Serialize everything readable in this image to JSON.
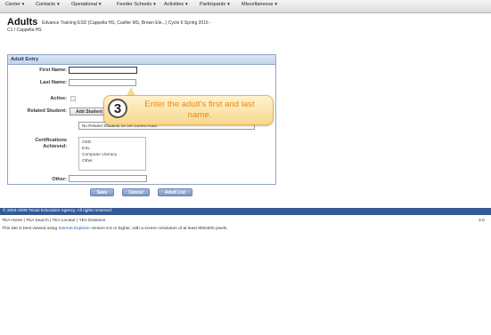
{
  "nav": {
    "items": [
      "Center",
      "Contacts",
      "Operational",
      "Feeder Schools",
      "Activities",
      "Participants",
      "Miscellaneous"
    ]
  },
  "page": {
    "title": "Adults",
    "subtitle": "Edvance Training ESD (Cappella HS, Cueller MS, Brown Ele...)  Cycle 6  Spring 2016 -",
    "subtitle2": "C1 / Cappella HS"
  },
  "form": {
    "panel_title": "Adult Entry",
    "first_name_label": "First Name:",
    "first_name_value": "",
    "last_name_label": "Last Name:",
    "last_name_value": "",
    "active_label": "Active:",
    "related_label": "Related Student:",
    "add_student_label": "Add Student",
    "related_empty": "No Related Students for the current Adult.",
    "certifications_label": "Certifications Achieved:",
    "certifications_options": [
      "GED",
      "ESL",
      "Computer Literacy",
      "Other"
    ],
    "other_label": "Other:",
    "other_value": ""
  },
  "buttons": {
    "save": "Save",
    "cancel": "Cancel",
    "adult_list": "Adult List"
  },
  "callout": {
    "number": "3",
    "text": "Enter the adult's first and last name."
  },
  "footer": {
    "copyright": "© 2004-2009 Texas Education Agency. All rights reserved.",
    "links": "TEA Home | TEA Search | TEA Locator | TEA Divisions",
    "version": "3.0",
    "best_viewed_prefix": "This site is best viewed using",
    "best_viewed_link": "Internet Explorer",
    "best_viewed_suffix": "version 5.5 or higher, with a screen resolution of at least 800x600 pixels."
  },
  "colors": {
    "footer_bar": "#345a94",
    "callout_text": "#e68b12",
    "panel_border": "#8ea6c8"
  }
}
